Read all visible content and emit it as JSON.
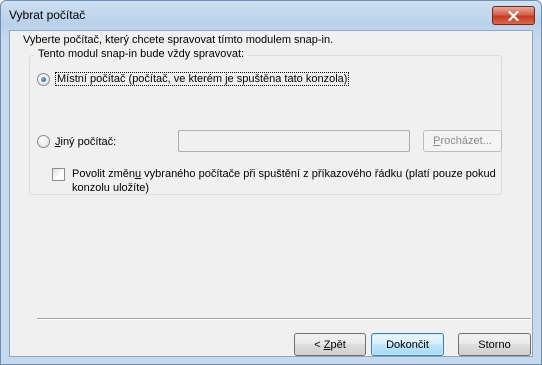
{
  "window": {
    "title": "Vybrat počítač"
  },
  "intro_text": "Vyberte počítač, který chcete spravovat tímto modulem snap-in.",
  "group": {
    "legend": "Tento modul snap-in bude vždy spravovat:",
    "local_option": {
      "label": "Místní počítač (počítač, ve kterém je spuštěna tato konzola)",
      "selected": true
    },
    "other_option": {
      "label_pre": "",
      "label_underlined": "J",
      "label_post": "iný počítač:",
      "selected": false
    },
    "computer_input": {
      "value": "",
      "enabled": false
    },
    "browse_button": {
      "label_underlined": "P",
      "label_post": "rocházet...",
      "enabled": false
    },
    "allow_change_checkbox": {
      "label_pre": "Povolit změn",
      "label_underlined": "u",
      "label_post": " vybraného počítače při spuštění z příkazového řádku (platí pouze pokud konzolu uložíte)",
      "checked": false
    }
  },
  "buttons": {
    "back": {
      "label_pre": "< ",
      "label_underlined": "Z",
      "label_post": "pět"
    },
    "finish": {
      "label": "Dokončit"
    },
    "cancel": {
      "label": "Storno"
    }
  },
  "icons": {
    "close": "close-icon"
  },
  "colors": {
    "title_bar": "#b9d1ea",
    "client_bg": "#f0f0f0",
    "close_button": "#c53b22",
    "default_button_border": "#3c7fb1"
  }
}
